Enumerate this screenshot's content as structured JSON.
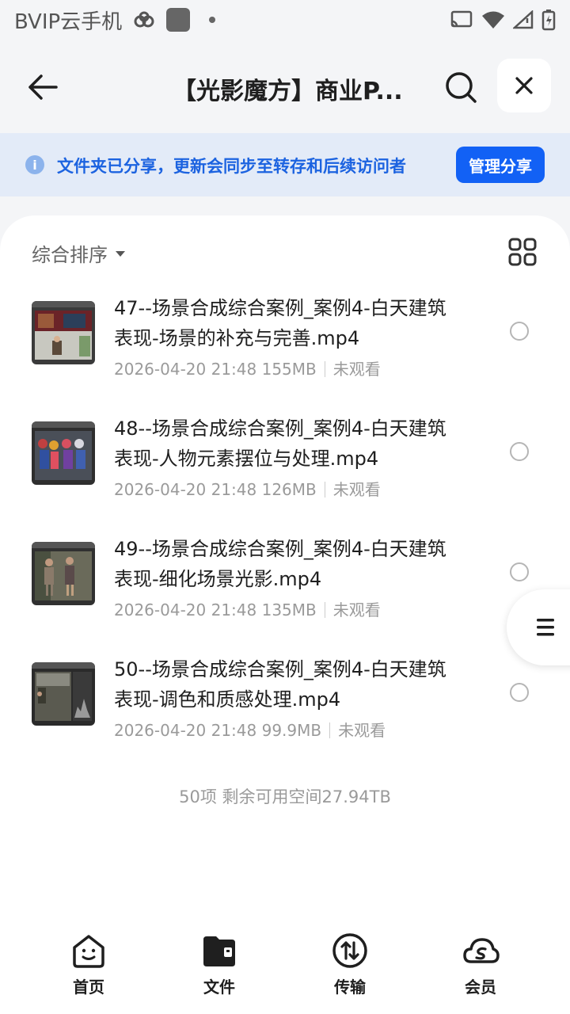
{
  "status": {
    "app_name": "BVIP云手机"
  },
  "header": {
    "title": "【光影魔方】商业P..."
  },
  "banner": {
    "text": "文件夹已分享，更新会同步至转存和后续访问者",
    "button": "管理分享"
  },
  "sort": {
    "label": "综合排序"
  },
  "files": [
    {
      "name": "47--场景合成综合案例_案例4-白天建筑表现-场景的补充与完善.mp4",
      "date": "2026-04-20 21:48",
      "size": "155MB",
      "status": "未观看"
    },
    {
      "name": "48--场景合成综合案例_案例4-白天建筑表现-人物元素摆位与处理.mp4",
      "date": "2026-04-20 21:48",
      "size": "126MB",
      "status": "未观看"
    },
    {
      "name": "49--场景合成综合案例_案例4-白天建筑表现-细化场景光影.mp4",
      "date": "2026-04-20 21:48",
      "size": "135MB",
      "status": "未观看"
    },
    {
      "name": "50--场景合成综合案例_案例4-白天建筑表现-调色和质感处理.mp4",
      "date": "2026-04-20 21:48",
      "size": "99.9MB",
      "status": "未观看"
    }
  ],
  "footer": {
    "count": "50项 剩余可用空间27.94TB"
  },
  "nav": {
    "home": "首页",
    "files": "文件",
    "transfer": "传输",
    "member": "会员"
  },
  "colors": {
    "accent": "#1261f5",
    "banner_bg": "#e3ebf8",
    "banner_text": "#1c63e0"
  },
  "icons": [
    "back-arrow-icon",
    "search-icon",
    "close-icon",
    "info-icon",
    "sort-caret-icon",
    "grid-view-icon",
    "list-menu-icon",
    "home-smile-icon",
    "folder-icon",
    "transfer-icon",
    "member-cloud-icon"
  ]
}
